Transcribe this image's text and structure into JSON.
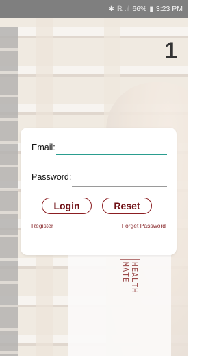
{
  "statusbar": {
    "bluetooth_icon": "bluetooth-icon",
    "signal_icons": "signal-icon",
    "battery": "66%",
    "time": "3:23 PM"
  },
  "page_number": "1",
  "background": {
    "brand_text": "HEALTH MATE"
  },
  "login": {
    "email_label": "Email:",
    "email_value": "",
    "password_label": "Password:",
    "password_value": "",
    "login_button": "Login",
    "reset_button": "Reset",
    "register_link": "Register",
    "forgot_link": "Forget Password"
  },
  "colors": {
    "accent": "#8b1e22",
    "focus": "#2a9d8f",
    "statusbar": "#7f7f7f"
  }
}
